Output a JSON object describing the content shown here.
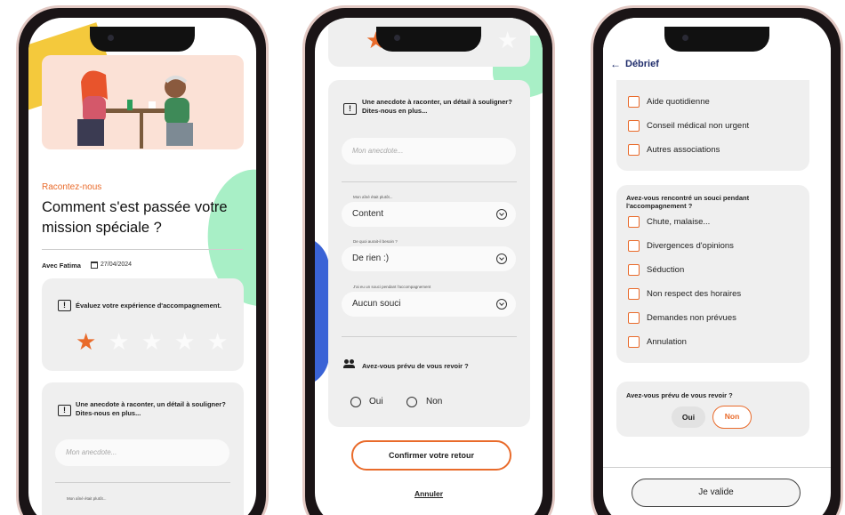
{
  "colors": {
    "accent": "#e96b2b",
    "navy": "#1f2c6b",
    "card": "#efefef",
    "mint": "#a8efc6",
    "yellow": "#f4c93c",
    "blue": "#3a63d6"
  },
  "screen1": {
    "section_label": "Racontez-nous",
    "title": "Comment s'est passée votre mission spéciale ?",
    "with_text": "Avec Fatima",
    "date": "27/04/2024",
    "calendar_icon": "calendar-icon",
    "rating_question": "Évaluez votre expérience d'accompagnement.",
    "rating_value": 1,
    "rating_max": 5,
    "anecdote_question": "Une anecdote à raconter, un détail à souligner? Dites-nous en plus...",
    "anecdote_placeholder": "Mon anecdote...",
    "small_label": "Mon aîné était plutôt..."
  },
  "screen2": {
    "anecdote_question": "Une anecdote à raconter, un détail à souligner? Dites-nous en plus...",
    "anecdote_placeholder": "Mon anecdote...",
    "select1_label": "Mon aîné était plutôt...",
    "select1_value": "Content",
    "select2_label": "De quoi aurait-il besoin ?",
    "select2_value": "De rien :)",
    "select3_label": "J'ai eu un souci pendant l'accompagnement",
    "select3_value": "Aucun souci",
    "revoir_question": "Avez-vous prévu de vous revoir ?",
    "opt_yes": "Oui",
    "opt_no": "Non",
    "confirm_button": "Confirmer votre retour",
    "cancel_link": "Annuler"
  },
  "screen3": {
    "back_icon": "arrow-left-icon",
    "header_title": "Débrief",
    "help_options": [
      "Aide quotidienne",
      "Conseil médical non urgent",
      "Autres associations"
    ],
    "issue_question": "Avez-vous rencontré un souci pendant l'accompagnement ?",
    "issue_options": [
      "Chute, malaise...",
      "Divergences d'opinions",
      "Séduction",
      "Non respect des horaires",
      "Demandes non prévues",
      "Annulation"
    ],
    "revoir_question": "Avez-vous prévu de vous revoir ?",
    "btn_yes": "Oui",
    "btn_no": "Non",
    "validate_button": "Je valide"
  }
}
